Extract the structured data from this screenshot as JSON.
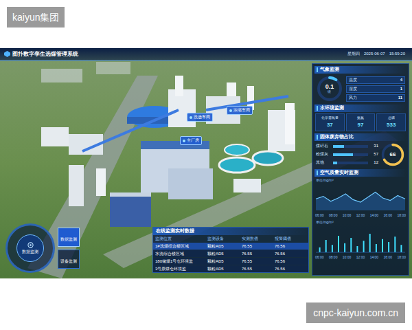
{
  "watermark": {
    "text": "kaiyun集团"
  },
  "footer": {
    "text": "cnpc-kaiyun.com.cn"
  },
  "dashboard": {
    "title": "图扑数字孪生选煤管理系统",
    "weekday": "星期四",
    "date": "2025-06-07",
    "time": "15:59:20"
  },
  "scene_labels": [
    {
      "text": "洗选车间"
    },
    {
      "text": "浓缩车间"
    },
    {
      "text": "主厂房"
    }
  ],
  "nav": {
    "center": "数据监测",
    "items": [
      {
        "label": "数据监测",
        "selected": true
      },
      {
        "label": "设备监测",
        "selected": false
      }
    ]
  },
  "weather": {
    "title": "气象监测",
    "gauge": {
      "value": "0.1",
      "unit": "级",
      "level": 0.1
    },
    "items": [
      {
        "label": "温度",
        "value": "4"
      },
      {
        "label": "湿度",
        "value": "1"
      },
      {
        "label": "风力",
        "value": "11"
      }
    ]
  },
  "water": {
    "title": "水环境监测",
    "items": [
      {
        "label": "化学需氧量",
        "value": "37"
      },
      {
        "label": "氨氮",
        "value": "97"
      },
      {
        "label": "总磷",
        "value": "533"
      }
    ]
  },
  "solid": {
    "title": "固体废弃物占比",
    "items": [
      {
        "label": "煤矸石",
        "value": "31",
        "level": 0.31
      },
      {
        "label": "粉煤灰",
        "value": "57",
        "level": 0.57
      },
      {
        "label": "其他",
        "value": "12",
        "level": 0.12
      }
    ],
    "gauge": {
      "value": "66",
      "level": 0.66
    }
  },
  "air": {
    "title": "空气质量实时监测",
    "chart1": {
      "unit": "单位/mg/m³",
      "max": 60,
      "values": [
        28,
        34,
        22,
        30,
        40,
        26,
        20,
        32,
        44,
        30,
        24,
        36,
        28
      ]
    },
    "chart2": {
      "unit": "单位/mg/m³",
      "max": 60,
      "values": [
        12,
        30,
        18,
        40,
        22,
        35,
        15,
        28,
        45,
        20,
        32,
        25,
        38,
        18
      ]
    },
    "ticks": [
      "06:00",
      "08:00",
      "10:00",
      "12:00",
      "14:00",
      "16:00",
      "18:00"
    ]
  },
  "table": {
    "title": "在线监测实时数据",
    "columns": [
      "监测位置",
      "监测设备",
      "实测数值",
      "报警阈值"
    ],
    "rows": [
      {
        "cells": [
          "1#洗煤综合楼区域",
          "颗粒AD5",
          "76.55",
          "76.56"
        ],
        "selected": true
      },
      {
        "cells": [
          "水洗综合楼区域",
          "颗粒AD5",
          "76.55",
          "76.56"
        ],
        "selected": false
      },
      {
        "cells": [
          "180储煤1号仓环境监",
          "颗粒AD5",
          "76.55",
          "76.56"
        ],
        "selected": false
      },
      {
        "cells": [
          "3号原煤仓环境监",
          "颗粒AD5",
          "76.55",
          "76.56"
        ],
        "selected": false
      }
    ]
  }
}
